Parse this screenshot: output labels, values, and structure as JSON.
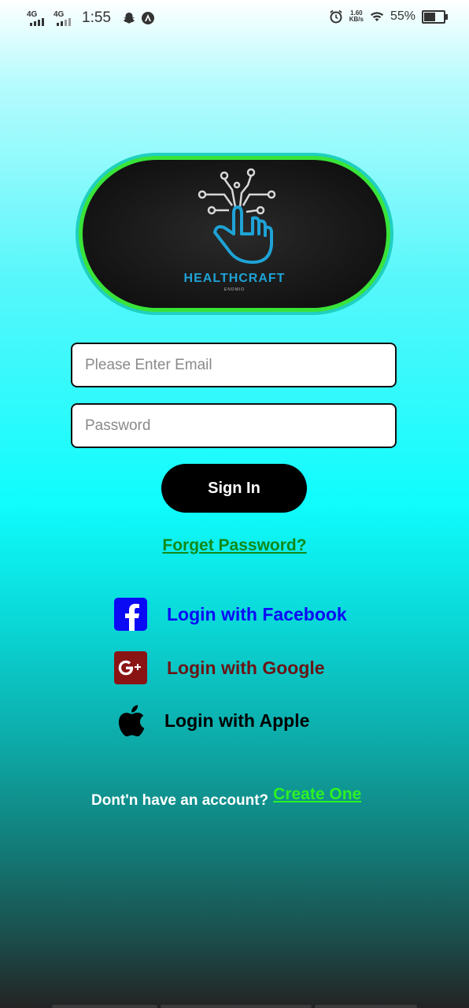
{
  "status_bar": {
    "network_1": "4G",
    "network_2": "4G",
    "time": "1:55",
    "speed_value": "1.60",
    "speed_unit": "KB/s",
    "battery_percent": "55%",
    "battery_level": 0.55,
    "icons": [
      "signal-icon",
      "snapchat-icon",
      "notification-icon",
      "alarm-icon",
      "wifi-icon",
      "battery-icon"
    ]
  },
  "logo": {
    "brand": "HEALTHCRAFT",
    "sub": "ENOMIO",
    "brand_color": "#1ea3d6"
  },
  "form": {
    "email_placeholder": "Please Enter Email",
    "email_value": "",
    "password_placeholder": "Password",
    "password_value": "",
    "signin_label": "Sign In",
    "forget_label": "Forget Password?"
  },
  "social": {
    "facebook_label": "Login with Facebook",
    "google_label": "Login with Google",
    "apple_label": "Login with Apple",
    "facebook_color": "#0a0af5",
    "google_color": "#6a1515",
    "apple_color": "#000000"
  },
  "footer": {
    "question": "Dont'n have an account?",
    "create_label": "Create One"
  }
}
